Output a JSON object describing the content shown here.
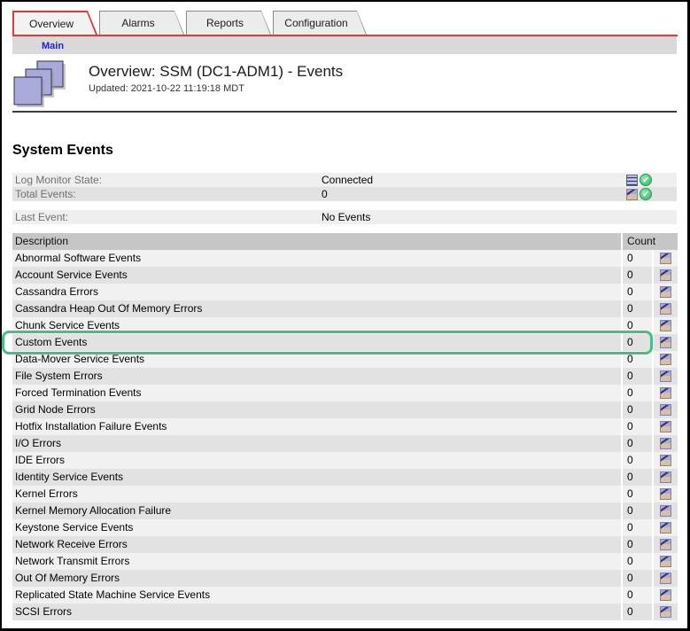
{
  "tabs": [
    {
      "label": "Overview",
      "active": true
    },
    {
      "label": "Alarms",
      "active": false
    },
    {
      "label": "Reports",
      "active": false
    },
    {
      "label": "Configuration",
      "active": false
    }
  ],
  "breadcrumb": {
    "main_link": "Main"
  },
  "header": {
    "title": "Overview: SSM (DC1-ADM1) - Events",
    "updated": "Updated: 2021-10-22 11:19:18 MDT"
  },
  "system_events": {
    "heading": "System Events",
    "info_rows": [
      {
        "label": "Log Monitor State:",
        "value": "Connected",
        "icons": [
          "log-file-icon",
          "status-ok-icon"
        ],
        "alt": false,
        "gap": false
      },
      {
        "label": "Total Events:",
        "value": "0",
        "icons": [
          "chart-icon",
          "status-ok-icon"
        ],
        "alt": true,
        "gap": false
      },
      {
        "label": "Last Event:",
        "value": "No Events",
        "icons": [],
        "alt": false,
        "gap": true
      }
    ]
  },
  "events_table": {
    "columns": {
      "description": "Description",
      "count": "Count"
    },
    "rows": [
      {
        "description": "Abnormal Software Events",
        "count": "0",
        "icon": "chart-icon",
        "highlighted": false
      },
      {
        "description": "Account Service Events",
        "count": "0",
        "icon": "chart-icon",
        "highlighted": false
      },
      {
        "description": "Cassandra Errors",
        "count": "0",
        "icon": "chart-icon",
        "highlighted": false
      },
      {
        "description": "Cassandra Heap Out Of Memory Errors",
        "count": "0",
        "icon": "chart-icon",
        "highlighted": false
      },
      {
        "description": "Chunk Service Events",
        "count": "0",
        "icon": "chart-icon",
        "highlighted": false
      },
      {
        "description": "Custom Events",
        "count": "0",
        "icon": "chart-icon",
        "highlighted": true
      },
      {
        "description": "Data-Mover Service Events",
        "count": "0",
        "icon": "chart-icon",
        "highlighted": false
      },
      {
        "description": "File System Errors",
        "count": "0",
        "icon": "chart-icon",
        "highlighted": false
      },
      {
        "description": "Forced Termination Events",
        "count": "0",
        "icon": "chart-icon",
        "highlighted": false
      },
      {
        "description": "Grid Node Errors",
        "count": "0",
        "icon": "chart-icon",
        "highlighted": false
      },
      {
        "description": "Hotfix Installation Failure Events",
        "count": "0",
        "icon": "chart-icon",
        "highlighted": false
      },
      {
        "description": "I/O Errors",
        "count": "0",
        "icon": "chart-icon",
        "highlighted": false
      },
      {
        "description": "IDE Errors",
        "count": "0",
        "icon": "chart-icon",
        "highlighted": false
      },
      {
        "description": "Identity Service Events",
        "count": "0",
        "icon": "chart-icon",
        "highlighted": false
      },
      {
        "description": "Kernel Errors",
        "count": "0",
        "icon": "chart-icon",
        "highlighted": false
      },
      {
        "description": "Kernel Memory Allocation Failure",
        "count": "0",
        "icon": "chart-icon",
        "highlighted": false
      },
      {
        "description": "Keystone Service Events",
        "count": "0",
        "icon": "chart-icon",
        "highlighted": false
      },
      {
        "description": "Network Receive Errors",
        "count": "0",
        "icon": "chart-icon",
        "highlighted": false
      },
      {
        "description": "Network Transmit Errors",
        "count": "0",
        "icon": "chart-icon",
        "highlighted": false
      },
      {
        "description": "Out Of Memory Errors",
        "count": "0",
        "icon": "chart-icon",
        "highlighted": false
      },
      {
        "description": "Replicated State Machine Service Events",
        "count": "0",
        "icon": "chart-icon",
        "highlighted": false
      },
      {
        "description": "SCSI Errors",
        "count": "0",
        "icon": "chart-icon",
        "highlighted": false
      }
    ]
  },
  "colors": {
    "accent_red": "#dd3a3c",
    "highlight_green": "#49bc8a",
    "status_ok_green": "#2fb862",
    "icon_lavender": "#a9a9da",
    "icon_tan": "#d9bfa6",
    "link_blue": "#2222cc"
  }
}
